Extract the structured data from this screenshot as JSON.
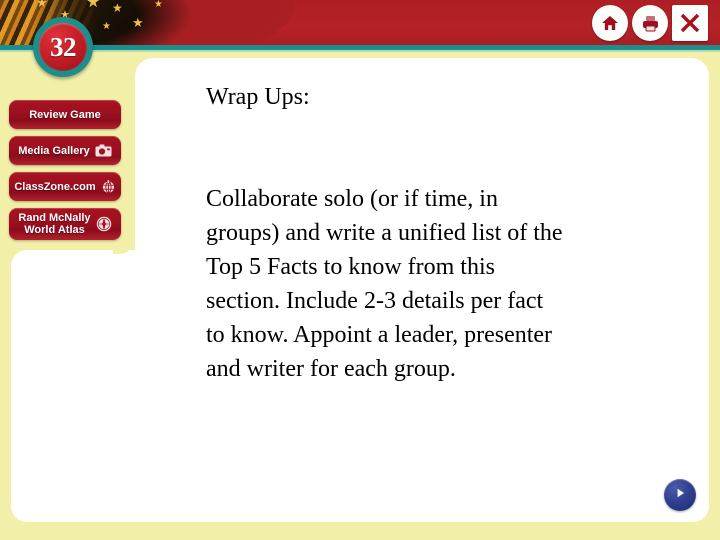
{
  "header": {
    "chapter_number": "32",
    "banner_color": "#b01f24",
    "divider_color": "#1b8f8c",
    "flag_stars": 7,
    "controls": [
      {
        "name": "home-icon",
        "label": "Home"
      },
      {
        "name": "print-icon",
        "label": "Print"
      },
      {
        "name": "close-icon",
        "label": "Close"
      }
    ]
  },
  "sidebar": {
    "background_color": "#f2efa8",
    "button_color": "#9e1020",
    "items": [
      {
        "label": "Review Game",
        "icon": ""
      },
      {
        "label": "Media Gallery",
        "icon": "camera-icon"
      },
      {
        "label": "ClassZone.com",
        "icon": "pointing-hand-globe-icon"
      },
      {
        "label": "Rand McNally\nWorld Atlas",
        "icon": "compass-rose-icon"
      }
    ]
  },
  "slide": {
    "heading": "Wrap Ups:",
    "body": "Collaborate solo (or if time, in groups) and write a unified list of the Top 5 Facts to know from this section. Include 2-3 details per fact to know. Appoint a leader, presenter and writer for each group.",
    "panel_color": "#ffffff",
    "text_color": "#000000"
  },
  "navigation": {
    "next_label": "Next",
    "next_color": "#2f3f8f"
  }
}
